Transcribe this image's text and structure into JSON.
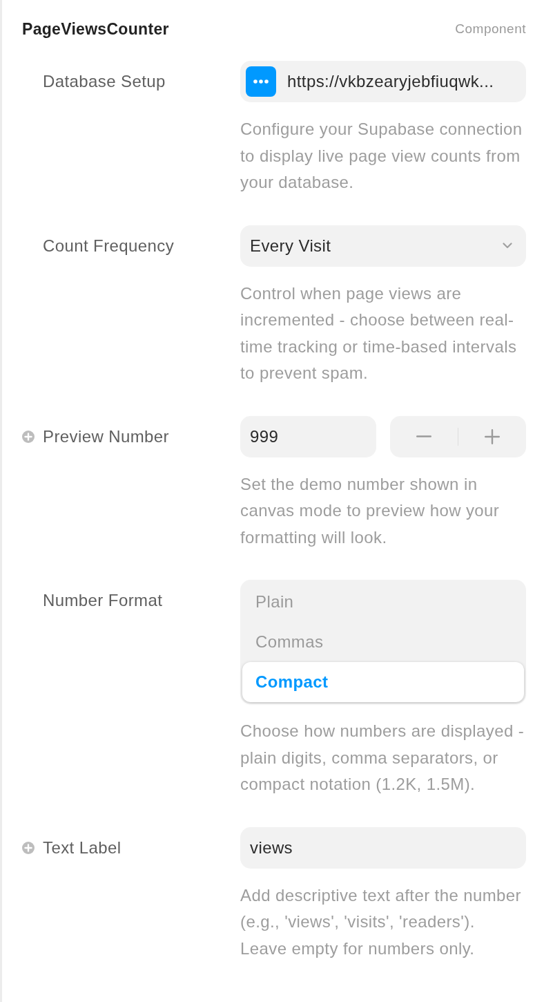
{
  "panel": {
    "title": "PageViewsCounter",
    "type_label": "Component"
  },
  "properties": [
    {
      "kind": "link_field",
      "label": "Database Setup",
      "addable": false,
      "value": "https://vkbzearyjebfiuqwk...",
      "description": "Configure your Supabase connection to display live page view counts from your database."
    },
    {
      "kind": "dropdown",
      "label": "Count Frequency",
      "addable": false,
      "value": "Every Visit",
      "description": "Control when page views are incremented - choose between real-time tracking or time-based intervals to prevent spam."
    },
    {
      "kind": "stepper",
      "label": "Preview Number",
      "addable": true,
      "value": "999",
      "description": "Set the demo number shown in canvas mode to preview how your formatting will look."
    },
    {
      "kind": "segmented",
      "label": "Number Format",
      "addable": false,
      "options": [
        {
          "label": "Plain",
          "selected": false
        },
        {
          "label": "Commas",
          "selected": false
        },
        {
          "label": "Compact",
          "selected": true
        }
      ],
      "description": "Choose how numbers are displayed - plain digits, comma separators, or compact notation (1.2K, 1.5M)."
    },
    {
      "kind": "text",
      "label": "Text Label",
      "addable": true,
      "value": "views",
      "description": "Add descriptive text after the number (e.g., 'views', 'visits', 'readers'). Leave empty for numbers only."
    }
  ]
}
